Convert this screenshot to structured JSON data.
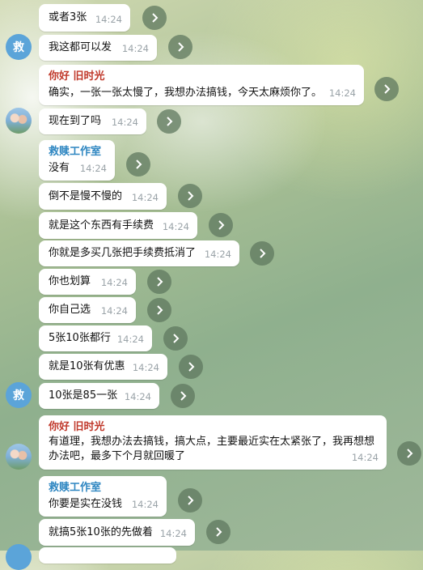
{
  "messages": [
    {
      "text": "或者3张",
      "time": "14:24"
    },
    {
      "text": "我这都可以发",
      "time": "14:24",
      "avatar": "救"
    },
    {
      "name": "你好 旧时光",
      "text": "确实，一张一张太慢了，我想办法搞钱，今天太麻烦你了。",
      "time": "14:24"
    },
    {
      "text": "现在到了吗",
      "time": "14:24"
    },
    {
      "name": "救赎工作室",
      "text": "没有",
      "time": "14:24"
    },
    {
      "text": "倒不是慢不慢的",
      "time": "14:24"
    },
    {
      "text": "就是这个东西有手续费",
      "time": "14:24"
    },
    {
      "text": "你就是多买几张把手续费抵消了",
      "time": "14:24"
    },
    {
      "text": "你也划算",
      "time": "14:24"
    },
    {
      "text": "你自己选",
      "time": "14:24"
    },
    {
      "text": "5张10张都行",
      "time": "14:24"
    },
    {
      "text": "就是10张有优惠",
      "time": "14:24"
    },
    {
      "text": "10张是85一张",
      "time": "14:24",
      "avatar": "救"
    },
    {
      "name": "你好 旧时光",
      "text": "有道理，我想办法去搞钱，搞大点，主要最近实在太紧张了，我再想想",
      "text2": "办法吧，最多下个月就回暖了",
      "time": "14:24"
    },
    {
      "name": "救赎工作室",
      "text": "你要是实在没钱",
      "time": "14:24"
    },
    {
      "text": "就搞5张10张的先做着",
      "time": "14:24"
    }
  ],
  "colors": {
    "name_red": "#c0392b",
    "name_blue": "#2e86c1",
    "avatar_blue": "#5ba4d9"
  },
  "icons": {
    "forward": "forward-arrow-icon",
    "avatar_photo": "user-photo-avatar"
  }
}
